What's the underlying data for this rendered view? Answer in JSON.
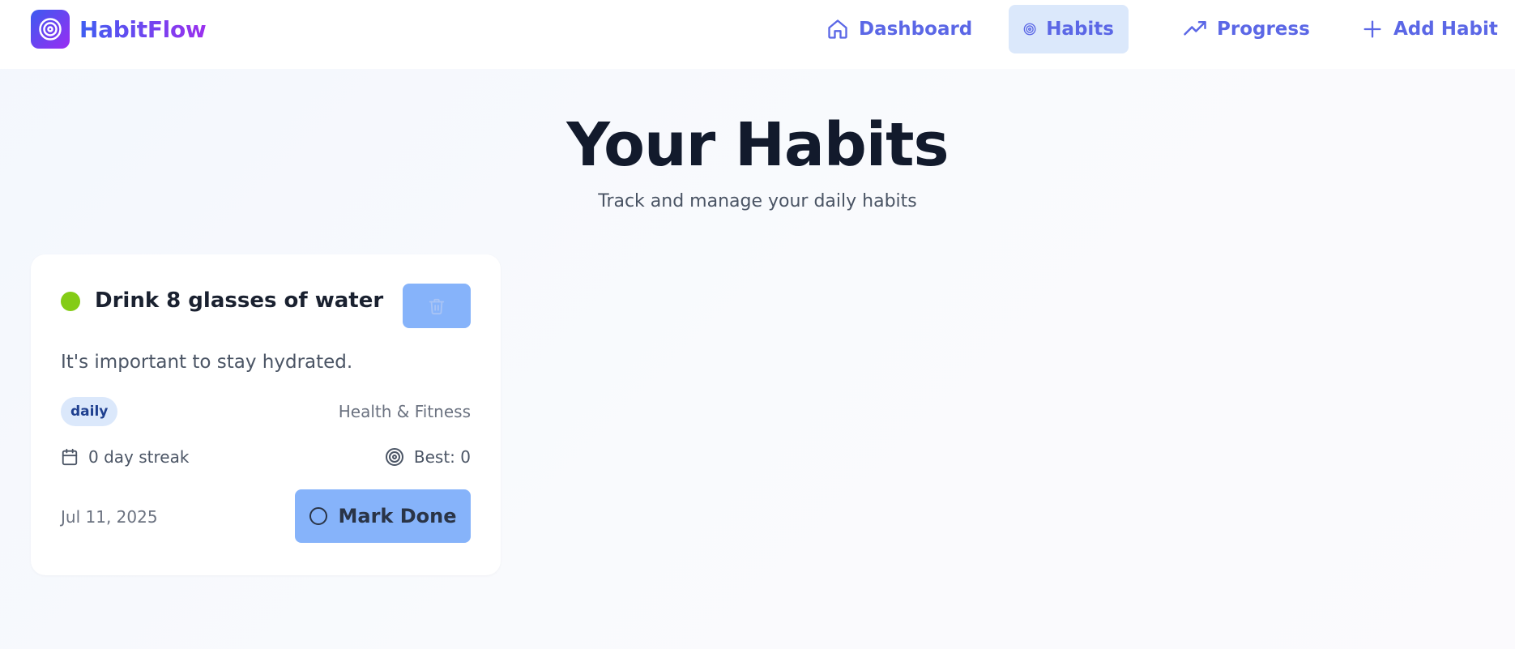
{
  "brand": {
    "name": "HabitFlow",
    "logo_icon": "target-icon"
  },
  "nav": {
    "items": [
      {
        "label": "Dashboard",
        "icon": "home-icon",
        "active": false
      },
      {
        "label": "Habits",
        "icon": "target-icon",
        "active": true
      },
      {
        "label": "Progress",
        "icon": "trending-up-icon",
        "active": false
      },
      {
        "label": "Add Habit",
        "icon": "plus-icon",
        "active": false
      }
    ]
  },
  "header": {
    "title": "Your Habits",
    "subtitle": "Track and manage your daily habits"
  },
  "habits": [
    {
      "title": "Drink 8 glasses of water",
      "status_color": "#84cc16",
      "description": "It's important to stay hydrated.",
      "frequency": "daily",
      "category": "Health & Fitness",
      "streak": "0 day streak",
      "best": "Best: 0",
      "date": "Jul 11, 2025",
      "action_label": "Mark Done",
      "delete_icon": "trash-icon"
    }
  ],
  "colors": {
    "accent": "#5b67e6",
    "active_nav_bg": "#dbe8fb",
    "button_bg": "#86b3fa",
    "brand_gradient_start": "#3b5bf0",
    "brand_gradient_end": "#9a2cf2"
  }
}
